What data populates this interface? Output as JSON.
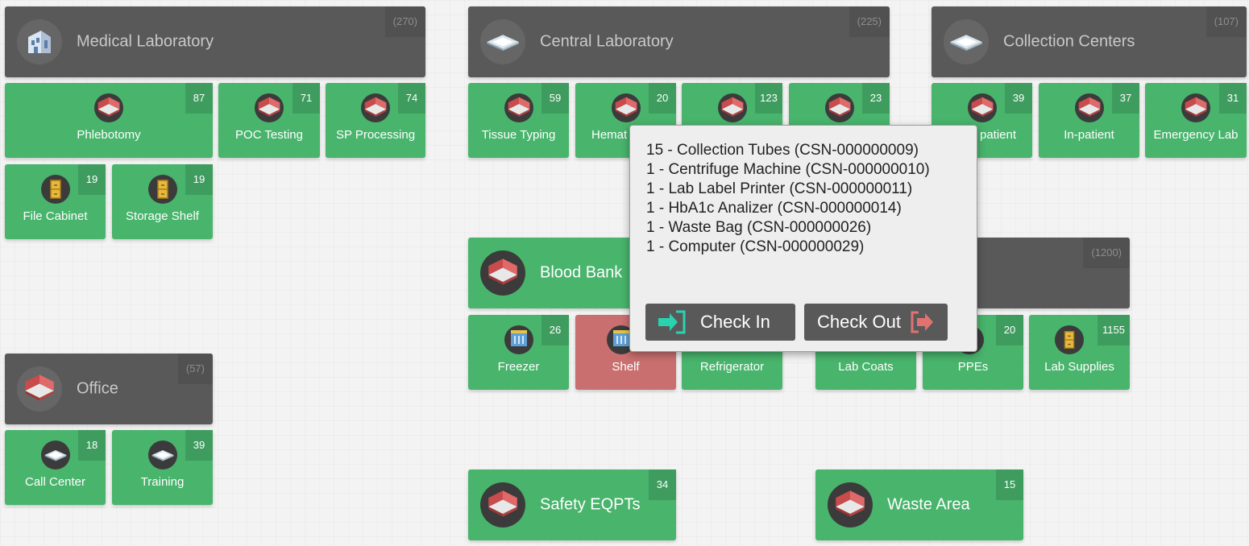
{
  "groups": {
    "medical_laboratory": {
      "name": "Medical Laboratory",
      "count": "(270)"
    },
    "central_laboratory": {
      "name": "Central Laboratory",
      "count": "(225)"
    },
    "collection_centers": {
      "name": "Collection Centers",
      "count": "(107)"
    },
    "office": {
      "name": "Office",
      "count": "(57)"
    },
    "storage": {
      "count": "(1200)"
    }
  },
  "tiles": {
    "phlebotomy": {
      "name": "Phlebotomy",
      "count": "87"
    },
    "poc_testing": {
      "name": "POC Testing",
      "count": "71"
    },
    "sp_processing": {
      "name": "SP Processing",
      "count": "74"
    },
    "file_cabinet": {
      "name": "File Cabinet",
      "count": "19"
    },
    "storage_shelf": {
      "name": "Storage Shelf",
      "count": "19"
    },
    "tissue_typing": {
      "name": "Tissue Typing",
      "count": "59"
    },
    "hematology": {
      "name": "Hemat",
      "count": "20"
    },
    "central_tile_3": {
      "count": "123"
    },
    "central_tile_4": {
      "count": "23"
    },
    "out_patient": {
      "name": "patient",
      "count": "39"
    },
    "in_patient": {
      "name": "In-patient",
      "count": "37"
    },
    "emergency_lab": {
      "name": "Emergency Lab",
      "count": "31"
    },
    "blood_bank": {
      "name": "Blood Bank"
    },
    "freezer": {
      "name": "Freezer",
      "count": "26"
    },
    "shelf": {
      "name": "Shelf"
    },
    "refrigerator": {
      "name": "Refrigerator"
    },
    "lab_coats": {
      "name": "Lab Coats"
    },
    "ppes": {
      "name": "PPEs",
      "count": "20"
    },
    "lab_supplies": {
      "name": "Lab Supplies",
      "count": "1155"
    },
    "call_center": {
      "name": "Call Center",
      "count": "18"
    },
    "training": {
      "name": "Training",
      "count": "39"
    },
    "safety_eqpts": {
      "name": "Safety EQPTs",
      "count": "34"
    },
    "waste_area": {
      "name": "Waste Area",
      "count": "15"
    }
  },
  "popup": {
    "items": [
      "15 - Collection Tubes (CSN-000000009)",
      "1 - Centrifuge Machine (CSN-000000010)",
      "1 - Lab Label Printer (CSN-000000011)",
      "1 - HbA1c Analizer (CSN-000000014)",
      "1 - Waste Bag (CSN-000000026)",
      "1 - Computer (CSN-000000029)"
    ],
    "check_in": "Check In",
    "check_out": "Check Out"
  },
  "colors": {
    "header": "#595959",
    "tile_green": "#48b46c",
    "tile_alert": "#c96f6f",
    "check_in_icon": "#2ad3b0",
    "check_out_icon": "#e07272"
  }
}
